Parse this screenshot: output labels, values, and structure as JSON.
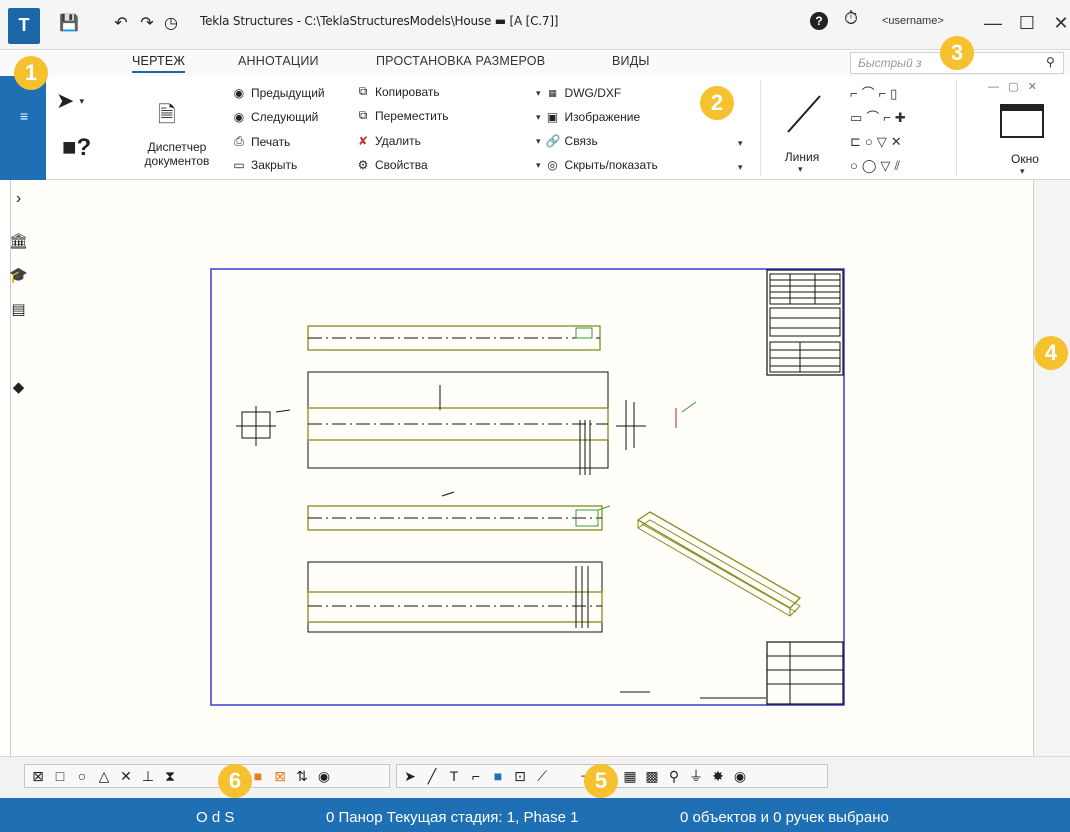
{
  "titlebar": {
    "logo": "logo-icon",
    "title": "Tekla Structures - C:\\TeklaStructuresModels\\House  ▬  [A  [C.7]]",
    "username": "<username>",
    "help": "?",
    "minimize": "—",
    "maximize": "☐",
    "close": "✕"
  },
  "tabs": [
    {
      "label": "ЧЕРТЕЖ",
      "active": true
    },
    {
      "label": "АННОТАЦИИ",
      "active": false
    },
    {
      "label": "ПРОСТАНОВКА РАЗМЕРОВ",
      "active": false
    },
    {
      "label": "ВИДЫ",
      "active": false
    }
  ],
  "search": {
    "placeholder": "Быстрый з"
  },
  "ribbon": {
    "doc_manager": "Диспетчер\nдокументов",
    "previous": "Предыдущий",
    "next": "Следующий",
    "print": "Печать",
    "close_doc": "Закрыть",
    "copy": "Копировать",
    "move": "Переместить",
    "delete": "Удалить",
    "properties": "Свойства",
    "dwg": "DWG/DXF",
    "image": "Изображение",
    "link": "Связь",
    "hide_show": "Скрыть/показать",
    "line": "Линия",
    "window": "Окно"
  },
  "status": {
    "left": "O d S",
    "middle": "0  Панор Текущая стадия: 1, Phase 1",
    "right": "0 объектов и 0 ручек выбрано"
  },
  "callouts": [
    "1",
    "2",
    "3",
    "4",
    "5",
    "6"
  ],
  "colors": {
    "accent": "#1f6fb5",
    "callout": "#f5c12e",
    "drawing_line": "#8a8a20",
    "sheet_border": "#3a3ad0"
  }
}
